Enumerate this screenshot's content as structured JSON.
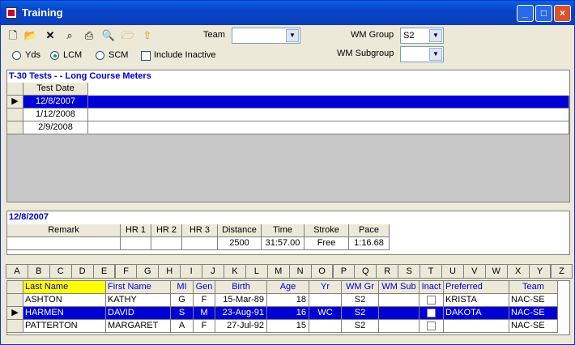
{
  "window": {
    "title": "Training"
  },
  "toolbar": {
    "icons": [
      "new-icon",
      "open-icon",
      "delete-icon",
      "find-icon",
      "print-icon",
      "print-preview-icon",
      "open-folder-icon",
      "import-icon"
    ],
    "team_label": "Team",
    "team_value": "",
    "wm_group_label": "WM Group",
    "wm_group_value": "S2",
    "wm_subgroup_label": "WM Subgroup",
    "wm_subgroup_value": ""
  },
  "course": {
    "yds": "Yds",
    "lcm": "LCM",
    "scm": "SCM",
    "selected": "LCM",
    "include_inactive": "Include Inactive",
    "include_inactive_checked": false
  },
  "tests": {
    "title": "T-30 Tests -  - Long Course Meters",
    "header": "Test Date",
    "rows": [
      "12/8/2007",
      "1/12/2008",
      "2/9/2008"
    ],
    "selected_index": 0
  },
  "detail": {
    "title": "12/8/2007",
    "headers": [
      "Remark",
      "HR 1",
      "HR 2",
      "HR 3",
      "Distance",
      "Time",
      "Stroke",
      "Pace"
    ],
    "values": [
      "",
      "",
      "",
      "",
      "2500",
      "31:57.00",
      "Free",
      "1:16.68"
    ]
  },
  "alphabet": [
    "A",
    "B",
    "C",
    "D",
    "E",
    "F",
    "G",
    "H",
    "I",
    "J",
    "K",
    "L",
    "M",
    "N",
    "O",
    "P",
    "Q",
    "R",
    "S",
    "T",
    "U",
    "V",
    "W",
    "X",
    "Y",
    "Z"
  ],
  "roster": {
    "headers": [
      "Last Name",
      "First Name",
      "MI",
      "Gen",
      "Birth",
      "Age",
      "Yr",
      "WM Gr",
      "WM Sub",
      "Inact",
      "Preferred",
      "Team"
    ],
    "rows": [
      {
        "last": "ASHTON",
        "first": "KATHY",
        "mi": "G",
        "gen": "F",
        "birth": "15-Mar-89",
        "age": "18",
        "yr": "",
        "wmgr": "S2",
        "wmsub": "",
        "pref": "KRISTA",
        "team": "NAC-SE"
      },
      {
        "last": "HARMEN",
        "first": "DAVID",
        "mi": "S",
        "gen": "M",
        "birth": "23-Aug-91",
        "age": "16",
        "yr": "WC",
        "wmgr": "S2",
        "wmsub": "",
        "pref": "DAKOTA",
        "team": "NAC-SE"
      },
      {
        "last": "PATTERTON",
        "first": "MARGARET",
        "mi": "A",
        "gen": "F",
        "birth": "27-Jul-92",
        "age": "15",
        "yr": "",
        "wmgr": "S2",
        "wmsub": "",
        "pref": "",
        "team": "NAC-SE"
      }
    ],
    "selected_index": 1
  }
}
